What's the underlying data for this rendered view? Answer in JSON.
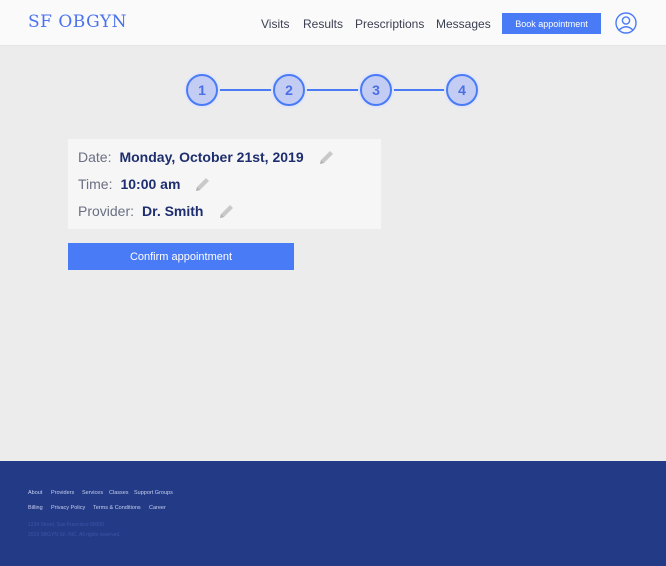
{
  "header": {
    "logo": "SF OBGYN",
    "nav": [
      "Visits",
      "Results",
      "Prescriptions",
      "Messages"
    ],
    "book_label": "Book appointment",
    "user_icon": "user-circle-icon"
  },
  "stepper": {
    "steps": [
      "1",
      "2",
      "3",
      "4"
    ],
    "accent": "#4a7bf7",
    "fill": "#c3ccf2"
  },
  "summary": {
    "date_label": "Date:",
    "date_value": "Monday, October 21st, 2019",
    "time_label": "Time:",
    "time_value": "10:00 am",
    "provider_label": "Provider:",
    "provider_value": "Dr. Smith",
    "edit_icon": "pencil-icon"
  },
  "confirm_label": "Confirm appointment",
  "footer": {
    "links_row1": [
      "About",
      "Providers",
      "Services",
      "Classes",
      "Support Groups"
    ],
    "links_row2": [
      "Billing",
      "Privacy Policy",
      "Terms & Conditions",
      "Career"
    ],
    "address": "1234 Street, San Francisco 00000",
    "copyright": "2019 SBGYN SF, INC. All rights reserved.",
    "bg": "#233a86"
  }
}
